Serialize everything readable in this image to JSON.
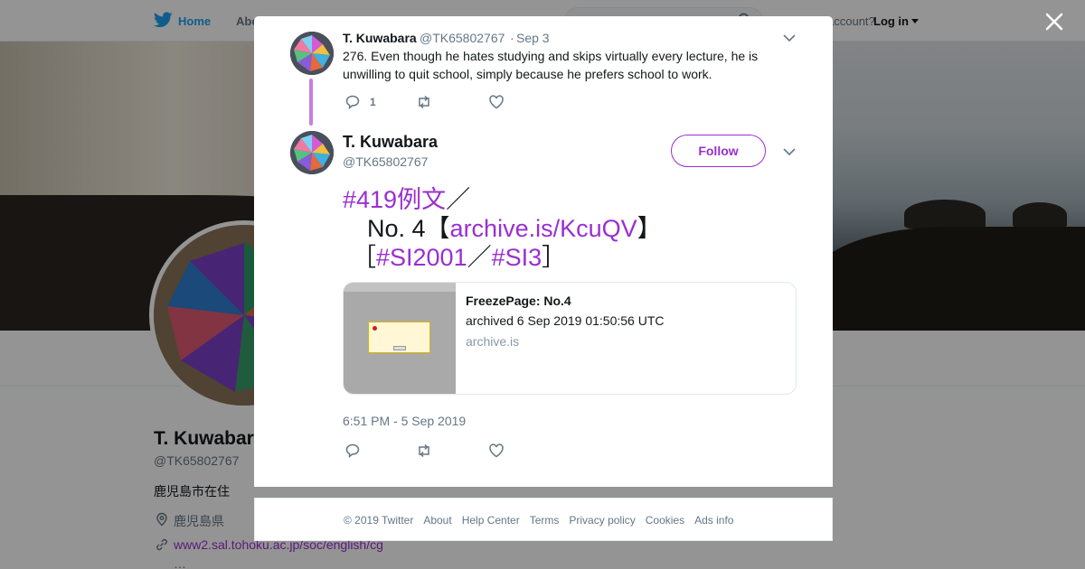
{
  "nav": {
    "home_label": "Home",
    "about_label": "Abo",
    "account_text": "account?",
    "login_label": "Log in"
  },
  "colors": {
    "link": "#9a2fd0",
    "thread_line": "#c77fe0",
    "twitter_blue": "#1da1f2"
  },
  "profile": {
    "name": "T. Kuwabara",
    "handle": "@TK65802767",
    "bio": "鹿児島市在住",
    "location": "鹿児島県",
    "url": "www2.sal.tohoku.ac.jp/soc/english/cg",
    "more": "…"
  },
  "thread_tweet": {
    "name": "T. Kuwabara",
    "handle": "@TK65802767",
    "separator": "·",
    "date": "Sep 3",
    "text": "276. Even though he hates studying and skips virtually every lecture, he is unwilling to quit school, simply because he prefers school to work.",
    "reply_count": "1"
  },
  "main_tweet": {
    "name": "T. Kuwabara",
    "handle": "@TK65802767",
    "follow_label": "Follow",
    "line1_hashtag": "#419例文",
    "line1_suffix": "／",
    "line2_prefix": "　No. 4【",
    "line2_link": "archive.is/KcuQV",
    "line2_suffix": "】",
    "line3_open": "［",
    "line3_tag1": "#SI2001",
    "line3_sep": "／",
    "line3_tag2": "#SI3",
    "line3_close": "］",
    "card": {
      "title": "FreezePage: No.4",
      "description": "archived 6 Sep 2019 01:50:56 UTC",
      "domain": "archive.is"
    },
    "timestamp": "6:51 PM - 5 Sep 2019"
  },
  "footer": {
    "links": [
      "© 2019 Twitter",
      "About",
      "Help Center",
      "Terms",
      "Privacy policy",
      "Cookies",
      "Ads info"
    ]
  },
  "icons": [
    "twitter-bird-icon",
    "search-icon",
    "close-icon",
    "chevron-down-icon",
    "reply-icon",
    "retweet-icon",
    "like-icon",
    "location-icon",
    "link-icon"
  ]
}
